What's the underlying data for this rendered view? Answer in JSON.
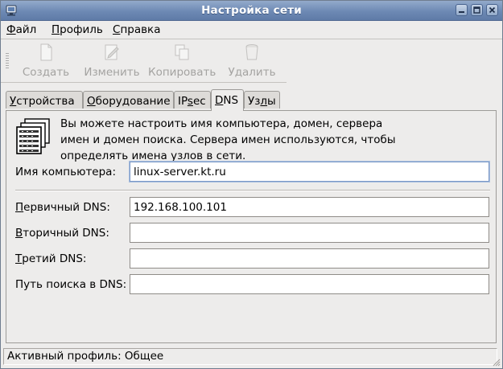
{
  "window": {
    "title": "Настройка сети",
    "app_icon": "network-icon",
    "controls": [
      "minimize-icon",
      "maximize-icon",
      "close-icon"
    ]
  },
  "menu": [
    {
      "label": "Файл"
    },
    {
      "label": "Профиль"
    },
    {
      "label": "Справка"
    }
  ],
  "toolbar": {
    "new_label": "Создать",
    "edit_label": "Изменить",
    "copy_label": "Копировать",
    "delete_label": "Удалить",
    "state": "disabled"
  },
  "tabs": [
    {
      "label": "Устройства"
    },
    {
      "label": "Оборудование"
    },
    {
      "label": "IPsec"
    },
    {
      "label": "DNS",
      "active": true
    },
    {
      "label": "Узлы"
    }
  ],
  "dns": {
    "info_lines": [
      "Вы можете настроить имя компьютера, домен, сервера",
      "имен и домен поиска. Сервера имен используются, чтобы",
      "определять имена узлов в сети."
    ],
    "hostname_label": "Имя компьютера:",
    "hostname_value": "linux-server.kt.ru",
    "primary_label": "Первичный DNS:",
    "primary_value": "192.168.100.101",
    "secondary_label": "Вторичный DNS:",
    "secondary_value": "",
    "tertiary_label": "Третий DNS:",
    "tertiary_value": "",
    "search_label": "Путь поиска в DNS:",
    "search_value": ""
  },
  "status": {
    "text": "Активный профиль: Общее"
  },
  "colors": {
    "titlebar": "#6d89b4",
    "background": "#edeceb",
    "focus_border": "#7b98c6",
    "disabled_text": "#a4a3a1"
  }
}
